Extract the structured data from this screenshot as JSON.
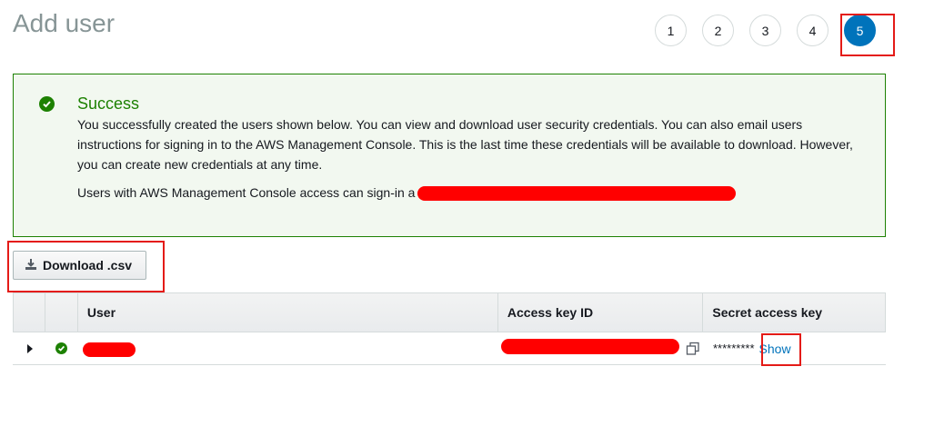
{
  "header": {
    "title": "Add user"
  },
  "steps": [
    "1",
    "2",
    "3",
    "4",
    "5"
  ],
  "active_step": "5",
  "alert": {
    "title": "Success",
    "body": "You successfully created the users shown below. You can view and download user security credentials. You can also email users instructions for signing in to the AWS Management Console. This is the last time these credentials will be available to download. However, you can create new credentials at any time.",
    "signin_text": "Users with AWS Management Console access can sign-in a"
  },
  "download_button": {
    "label": "Download .csv"
  },
  "table": {
    "columns": [
      "User",
      "Access key ID",
      "Secret access key"
    ],
    "rows": [
      {
        "secret_masked": "*********",
        "show_label": "Show"
      }
    ]
  },
  "colors": {
    "success": "#1d8102",
    "accent": "#0073bb",
    "highlight": "#e41b17",
    "redaction": "#ff0000"
  }
}
